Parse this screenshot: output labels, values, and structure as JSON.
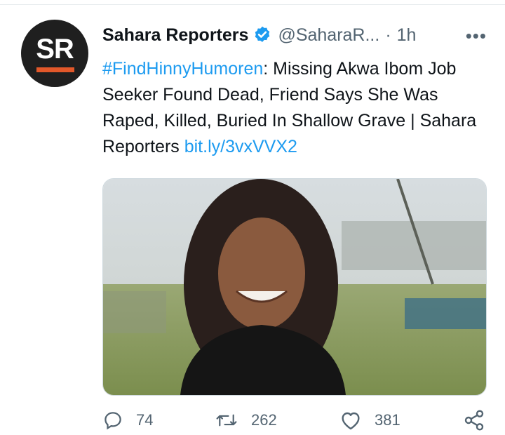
{
  "tweet": {
    "author": {
      "name": "Sahara Reporters",
      "handle": "@SaharaR...",
      "avatar_initials": "SR",
      "verified": true
    },
    "separator": "·",
    "time": "1h",
    "more_icon": "more-horizontal-icon",
    "hashtag": "#FindHinnyHumoren",
    "body": ": Missing Akwa Ibom Job Seeker Found Dead, Friend Says She Was Raped, Killed, Buried In Shallow Grave | Sahara Reporters ",
    "link": "bit.ly/3vxVVX2",
    "media": {
      "type": "photo",
      "subject": "smiling young woman with curly hair in a black top, outdoors"
    },
    "actions": {
      "replies": "74",
      "retweets": "262",
      "likes": "381",
      "reply_icon": "reply-icon",
      "retweet_icon": "retweet-icon",
      "like_icon": "heart-icon",
      "share_icon": "share-icon"
    }
  },
  "colors": {
    "accent": "#1d9bf0",
    "secondary_text": "#536471",
    "brand_bar": "#e2582a"
  }
}
